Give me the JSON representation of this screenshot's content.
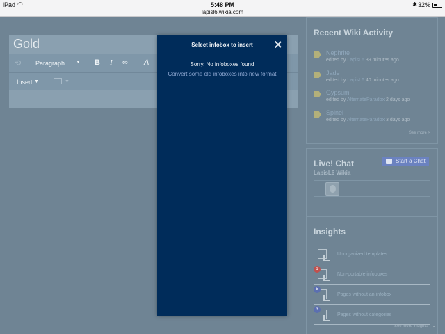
{
  "status_bar": {
    "device": "iPad",
    "time": "5:48 PM",
    "url": "lapisl6.wikia.com",
    "battery": "32%"
  },
  "editor": {
    "page_title": "Gold",
    "paragraph_label": "Paragraph",
    "bold": "B",
    "italic": "I",
    "insert_label": "Insert"
  },
  "recent_activity": {
    "title": "Recent Wiki Activity",
    "items": [
      {
        "name": "Nephrite",
        "prefix": "edited by",
        "user": "LapisL6",
        "when": "39 minutes ago"
      },
      {
        "name": "Jade",
        "prefix": "edited by",
        "user": "LapisL6",
        "when": "40 minutes ago"
      },
      {
        "name": "Gypsum",
        "prefix": "edited by",
        "user": "AlternateParadox",
        "when": "2 days ago"
      },
      {
        "name": "Spinel",
        "prefix": "edited by",
        "user": "AlternateParadox",
        "when": "3 days ago"
      }
    ],
    "see_more": "See more >"
  },
  "chat": {
    "title": "Live! Chat",
    "wiki_name": "LapisL6 Wikia",
    "start_button": "Start a Chat"
  },
  "insights": {
    "title": "Insights",
    "items": [
      {
        "label": "Unorganized templates",
        "badge": ""
      },
      {
        "label": "Non-portable infoboxes",
        "badge": "1",
        "badge_color": "#c0504d"
      },
      {
        "label": "Pages without an infobox",
        "badge": "5",
        "badge_color": "#5b6fb0"
      },
      {
        "label": "Pages without categories",
        "badge": "3",
        "badge_color": "#5b6fb0"
      }
    ],
    "see_more": "See more insights"
  },
  "modal": {
    "title": "Select infobox to insert",
    "message": "Sorry. No infoboxes found",
    "convert_link": "Convert some old infoboxes into new format"
  }
}
